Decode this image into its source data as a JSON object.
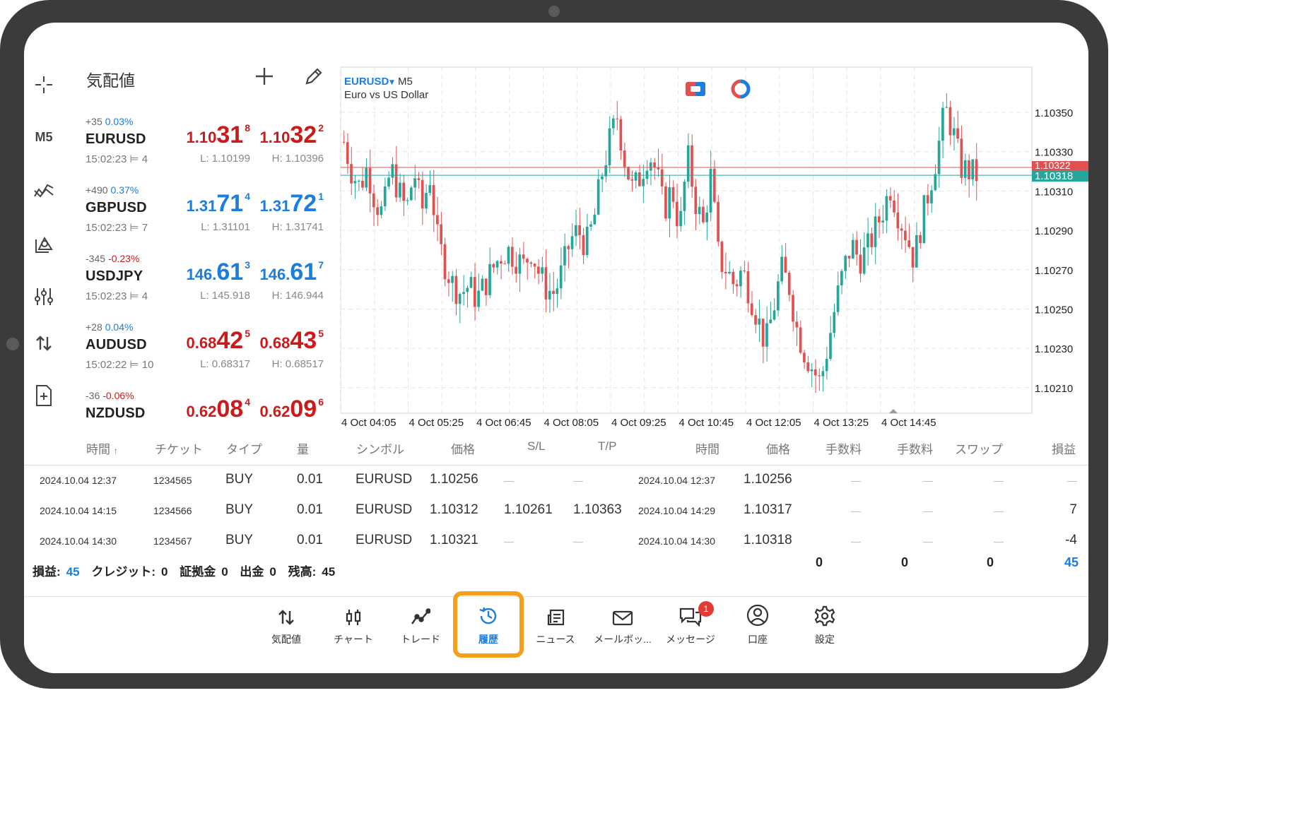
{
  "toolbar": {
    "timeframe_label": "M5",
    "icons": [
      "crosshair-icon",
      "timeframe",
      "indicators-icon",
      "objects-icon",
      "settings-sliders-icon",
      "trade-arrows-icon",
      "new-order-icon"
    ]
  },
  "quotes": {
    "title": "気配値",
    "add_icon": "plus-icon",
    "edit_icon": "pencil-icon",
    "items": [
      {
        "symbol": "EURUSD",
        "change_pts": "+35",
        "change_pct": "0.03%",
        "change_color": "#1a7de0",
        "time": "15:02:23",
        "spread": "4",
        "bid_pre": "1.10",
        "bid_big": "31",
        "bid_sup": "8",
        "bid_color": "#cc1a1a",
        "ask_pre": "1.10",
        "ask_big": "32",
        "ask_sup": "2",
        "ask_color": "#cc1a1a",
        "low": "L: 1.10199",
        "high": "H: 1.10396"
      },
      {
        "symbol": "GBPUSD",
        "change_pts": "+490",
        "change_pct": "0.37%",
        "change_color": "#1a7de0",
        "time": "15:02:23",
        "spread": "7",
        "bid_pre": "1.31",
        "bid_big": "71",
        "bid_sup": "4",
        "bid_color": "#1a7de0",
        "ask_pre": "1.31",
        "ask_big": "72",
        "ask_sup": "1",
        "ask_color": "#1a7de0",
        "low": "L: 1.31101",
        "high": "H: 1.31741"
      },
      {
        "symbol": "USDJPY",
        "change_pts": "-345",
        "change_pct": "-0.23%",
        "change_color": "#cc1a1a",
        "time": "15:02:23",
        "spread": "4",
        "bid_pre": "146.",
        "bid_big": "61",
        "bid_sup": "3",
        "bid_color": "#1a7de0",
        "ask_pre": "146.",
        "ask_big": "61",
        "ask_sup": "7",
        "ask_color": "#1a7de0",
        "low": "L: 145.918",
        "high": "H: 146.944"
      },
      {
        "symbol": "AUDUSD",
        "change_pts": "+28",
        "change_pct": "0.04%",
        "change_color": "#1a7de0",
        "time": "15:02:22",
        "spread": "10",
        "bid_pre": "0.68",
        "bid_big": "42",
        "bid_sup": "5",
        "bid_color": "#cc1a1a",
        "ask_pre": "0.68",
        "ask_big": "43",
        "ask_sup": "5",
        "ask_color": "#cc1a1a",
        "low": "L: 0.68317",
        "high": "H: 0.68517"
      },
      {
        "symbol": "NZDUSD",
        "change_pts": "-36",
        "change_pct": "-0.06%",
        "change_color": "#cc1a1a",
        "time": "",
        "spread": "",
        "bid_pre": "0.62",
        "bid_big": "08",
        "bid_sup": "4",
        "bid_color": "#cc1a1a",
        "ask_pre": "0.62",
        "ask_big": "09",
        "ask_sup": "6",
        "ask_color": "#cc1a1a",
        "low": "",
        "high": ""
      }
    ]
  },
  "chart": {
    "symbol": "EURUSD",
    "timeframe": "M5",
    "description": "Euro vs US Dollar",
    "bid_line_label": "1.10322",
    "ask_line_label": "1.10318",
    "colors": {
      "bull": "#26a69a",
      "bear": "#e05252",
      "grid": "#e6e6e6",
      "bid_line": "#e05252",
      "ask_line": "#26a69a"
    },
    "icons": [
      "one-click-trading-icon",
      "signal-icon"
    ]
  },
  "chart_data": {
    "type": "candlestick",
    "y_ticks": [
      "1.10350",
      "1.10330",
      "1.10310",
      "1.10290",
      "1.10270",
      "1.10250",
      "1.10230",
      "1.10210"
    ],
    "x_ticks": [
      "4 Oct 04:05",
      "4 Oct 05:25",
      "4 Oct 06:45",
      "4 Oct 08:05",
      "4 Oct 09:25",
      "4 Oct 10:45",
      "4 Oct 12:05",
      "4 Oct 13:25",
      "4 Oct 14:45"
    ],
    "ylim": [
      1.10197,
      1.10373
    ],
    "close_path": [
      1.10335,
      1.1032,
      1.10312,
      1.10322,
      1.10305,
      1.10298,
      1.10322,
      1.1031,
      1.103,
      1.1032,
      1.103,
      1.10318,
      1.10285,
      1.10272,
      1.10262,
      1.10258,
      1.10262,
      1.10255,
      1.10262,
      1.1027,
      1.10277,
      1.1028,
      1.10276,
      1.10272,
      1.1028,
      1.10268,
      1.1026,
      1.10258,
      1.1027,
      1.10285,
      1.1029,
      1.10282,
      1.10295,
      1.10318,
      1.10335,
      1.10348,
      1.10325,
      1.1031,
      1.10318,
      1.1033,
      1.1032,
      1.103,
      1.10312,
      1.1029,
      1.10328,
      1.10305,
      1.10292,
      1.10318,
      1.10275,
      1.1027,
      1.10262,
      1.1027,
      1.10258,
      1.10245,
      1.10232,
      1.1025,
      1.1027,
      1.10262,
      1.1024,
      1.10228,
      1.1022,
      1.10212,
      1.10232,
      1.10253,
      1.1027,
      1.10283,
      1.10275,
      1.1028,
      1.1029,
      1.103,
      1.10312,
      1.10298,
      1.10288,
      1.10275,
      1.10295,
      1.10312,
      1.1033,
      1.10352,
      1.1034,
      1.10322,
      1.1032,
      1.10318
    ]
  },
  "history": {
    "headers": {
      "time": "時間",
      "ticket": "チケット",
      "type": "タイプ",
      "volume": "量",
      "symbol": "シンボル",
      "price": "価格",
      "sl": "S/L",
      "tp": "T/P",
      "close_time": "時間",
      "close_price": "価格",
      "commission1": "手数料",
      "commission2": "手数料",
      "swap": "スワップ",
      "profit": "損益"
    },
    "rows": [
      {
        "time": "2024.10.04 12:37",
        "ticket": "1234565",
        "type": "BUY",
        "volume": "0.01",
        "symbol": "EURUSD",
        "price": "1.10256",
        "sl": "—",
        "tp": "—",
        "close_time": "2024.10.04 12:37",
        "close_price": "1.10256",
        "commission1": "—",
        "commission2": "—",
        "swap": "—",
        "profit": "—"
      },
      {
        "time": "2024.10.04 14:15",
        "ticket": "1234566",
        "type": "BUY",
        "volume": "0.01",
        "symbol": "EURUSD",
        "price": "1.10312",
        "sl": "1.10261",
        "tp": "1.10363",
        "close_time": "2024.10.04 14:29",
        "close_price": "1.10317",
        "commission1": "—",
        "commission2": "—",
        "swap": "—",
        "profit": "7"
      },
      {
        "time": "2024.10.04 14:30",
        "ticket": "1234567",
        "type": "BUY",
        "volume": "0.01",
        "symbol": "EURUSD",
        "price": "1.10321",
        "sl": "—",
        "tp": "—",
        "close_time": "2024.10.04 14:30",
        "close_price": "1.10318",
        "commission1": "—",
        "commission2": "—",
        "swap": "—",
        "profit": "-4"
      }
    ],
    "summary": {
      "profit_label": "損益:",
      "profit": "45",
      "credit_label": "クレジット:",
      "credit": "0",
      "margin_label": "証拠金",
      "margin": "0",
      "withdraw_label": "出金",
      "withdraw": "0",
      "balance_label": "残高:",
      "balance": "45"
    },
    "totals": {
      "commission1": "0",
      "commission2": "0",
      "swap": "0",
      "profit": "45"
    }
  },
  "nav": {
    "items": [
      {
        "label": "気配値",
        "icon": "quotes-arrows-icon"
      },
      {
        "label": "チャート",
        "icon": "chart-candles-icon"
      },
      {
        "label": "トレード",
        "icon": "trade-line-icon"
      },
      {
        "label": "履歴",
        "icon": "history-clock-icon"
      },
      {
        "label": "ニュース",
        "icon": "news-icon"
      },
      {
        "label": "メールボッ...",
        "icon": "mail-icon"
      },
      {
        "label": "メッセージ",
        "icon": "messages-icon",
        "badge": "1"
      },
      {
        "label": "口座",
        "icon": "account-icon"
      },
      {
        "label": "設定",
        "icon": "settings-gear-icon"
      }
    ],
    "active_index": 3,
    "highlight_color": "#f5a01a"
  }
}
